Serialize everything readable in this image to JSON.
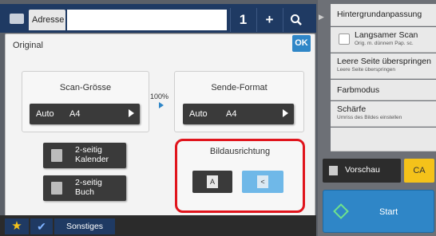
{
  "header": {
    "address_tab": "Adresse",
    "count": "1",
    "plus": "+",
    "search_icon": "search-icon"
  },
  "dialog": {
    "title": "Original",
    "ok": "OK",
    "scan_size": {
      "label": "Scan-Grösse",
      "value_left": "Auto",
      "value_right": "A4"
    },
    "percent": "100%",
    "send_format": {
      "label": "Sende-Format",
      "value_left": "Auto",
      "value_right": "A4"
    },
    "duplex_calendar": {
      "line1": "2-seitig",
      "line2": "Kalender"
    },
    "duplex_book": {
      "line1": "2-seitig",
      "line2": "Buch"
    },
    "orientation": {
      "label": "Bildausrichtung",
      "portrait_glyph": "A",
      "landscape_glyph": "<"
    }
  },
  "right_panel": {
    "items": [
      {
        "title": "Hintergrundanpassung",
        "sub": ""
      },
      {
        "title": "Langsamer Scan",
        "sub": "Orig. m. dünnem Pap. sc."
      },
      {
        "title": "Leere Seite überspringen",
        "sub": "Leere Seite überspringen"
      },
      {
        "title": "Farbmodus",
        "sub": ""
      },
      {
        "title": "Schärfe",
        "sub": "Umriss des Bildes einstellen"
      }
    ]
  },
  "bottom": {
    "sonstiges": "Sonstiges",
    "preview": "Vorschau",
    "ca": "CA",
    "start": "Start"
  },
  "colors": {
    "accent_blue": "#2f86c7",
    "highlight_red": "#e0141c",
    "ca_yellow": "#f4c21a"
  }
}
